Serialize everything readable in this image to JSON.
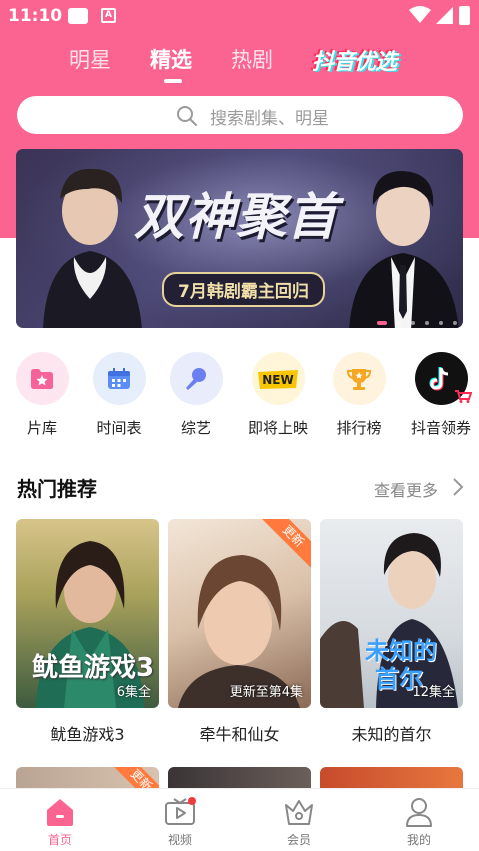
{
  "status_bar": {
    "time": "11:10",
    "icons": [
      "message-icon",
      "a-icon",
      "wifi-icon",
      "cellular-icon",
      "battery-icon"
    ]
  },
  "top_tabs": [
    {
      "label": "明星",
      "active": false
    },
    {
      "label": "精选",
      "active": true
    },
    {
      "label": "热剧",
      "active": false
    },
    {
      "label": "抖音优选",
      "active": false
    }
  ],
  "search": {
    "placeholder": "搜索剧集、明星",
    "icon": "search-icon"
  },
  "banner": {
    "title": "双神聚首",
    "subtitle": "7月韩剧霸主回归",
    "dot_count": 6,
    "active_dot": 0
  },
  "quick_entries": [
    {
      "label": "片库",
      "icon": "folder-star-icon",
      "bg": "#fde6ef",
      "fg": "#f6639a"
    },
    {
      "label": "时间表",
      "icon": "calendar-icon",
      "bg": "#e6eefc",
      "fg": "#5b8df5"
    },
    {
      "label": "综艺",
      "icon": "microphone-icon",
      "bg": "#e9ecfb",
      "fg": "#6b7ff0"
    },
    {
      "label": "即将上映",
      "icon": "new-icon",
      "bg": "#fff6d9",
      "fg": "#f7c600"
    },
    {
      "label": "排行榜",
      "icon": "trophy-icon",
      "bg": "#fff3dd",
      "fg": "#f5a623"
    },
    {
      "label": "抖音领券",
      "icon": "douyin-icon",
      "bg": "#111111",
      "fg": "#ffffff"
    }
  ],
  "section": {
    "title": "热门推荐",
    "more": "查看更多"
  },
  "cards": [
    {
      "title": "鱿鱼游戏3",
      "badge": "6集全",
      "overlay": "鱿鱼游戏3",
      "ribbon": ""
    },
    {
      "title": "牵牛和仙女",
      "badge": "更新至第4集",
      "overlay": "",
      "ribbon": "更新"
    },
    {
      "title": "未知的首尔",
      "badge": "12集全",
      "overlay": "未知的首尔",
      "ribbon": ""
    }
  ],
  "second_row": [
    {
      "ribbon": "更新"
    },
    {
      "ribbon": ""
    },
    {
      "ribbon": ""
    }
  ],
  "bottom_nav": [
    {
      "label": "首页",
      "icon": "home-icon",
      "active": true,
      "dot": false
    },
    {
      "label": "视频",
      "icon": "video-icon",
      "active": false,
      "dot": true
    },
    {
      "label": "会员",
      "icon": "vip-crown-icon",
      "active": false,
      "dot": false
    },
    {
      "label": "我的",
      "icon": "profile-icon",
      "active": false,
      "dot": false
    }
  ],
  "colors": {
    "brand_pink": "#fb6491",
    "ribbon_orange": "#ff7a3c"
  }
}
